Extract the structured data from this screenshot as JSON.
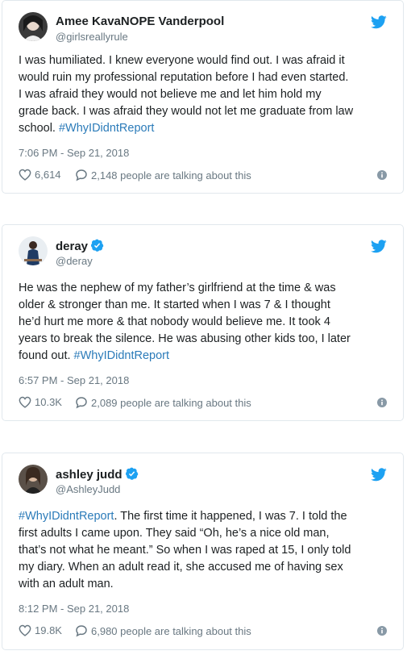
{
  "tweets": [
    {
      "name": "Amee KavaNOPE Vanderpool",
      "verified": false,
      "handle": "@girlsreallyrule",
      "lines": [
        [
          {
            "t": "I was humiliated. I knew everyone would find out. I was afraid it"
          }
        ],
        [
          {
            "t": "would ruin my professional reputation before I had even started."
          }
        ],
        [
          {
            "t": "I was afraid they would not believe me and let him hold my"
          }
        ],
        [
          {
            "t": "grade back. I was afraid they would not let me graduate from law"
          }
        ],
        [
          {
            "t": "school. "
          },
          {
            "t": "#WhyIDidntReport",
            "tag": true
          }
        ]
      ],
      "time": "7:06 PM - Sep 21, 2018",
      "likes": "6,614",
      "talking": "2,148 people are talking about this"
    },
    {
      "name": "deray",
      "verified": true,
      "handle": "@deray",
      "lines": [
        [
          {
            "t": "He was the nephew of my father’s girlfriend at the time & was"
          }
        ],
        [
          {
            "t": "older & stronger than me. It started when I was 7 & I thought"
          }
        ],
        [
          {
            "t": "he’d hurt me more & that nobody would believe me. It took 4"
          }
        ],
        [
          {
            "t": "years to break the silence. He was abusing other kids too, I later"
          }
        ],
        [
          {
            "t": "found out. "
          },
          {
            "t": "#WhyIDidntReport",
            "tag": true
          }
        ]
      ],
      "time": "6:57 PM - Sep 21, 2018",
      "likes": "10.3K",
      "talking": "2,089 people are talking about this"
    },
    {
      "name": "ashley judd",
      "verified": true,
      "handle": "@AshleyJudd",
      "lines": [
        [
          {
            "t": "#WhyIDidntReport",
            "tag": true
          },
          {
            "t": ". The first time it happened, I was 7. I told the"
          }
        ],
        [
          {
            "t": "first adults I came upon. They said “Oh, he’s a nice old man,"
          }
        ],
        [
          {
            "t": "that’s not what he meant.” So when I was raped at 15, I only told"
          }
        ],
        [
          {
            "t": "my diary. When an adult read it, she accused me of having sex"
          }
        ],
        [
          {
            "t": "with an adult man."
          }
        ]
      ],
      "time": "8:12 PM - Sep 21, 2018",
      "likes": "19.8K",
      "talking": "6,980 people are talking about this"
    }
  ],
  "colors": {
    "accent": "#1da1f2",
    "link": "#2b7bb9",
    "muted": "#697882",
    "border": "#e1e8ed"
  },
  "icons": [
    "twitter-bird-icon",
    "verified-badge-icon",
    "heart-icon",
    "reply-bubble-icon",
    "info-icon"
  ]
}
